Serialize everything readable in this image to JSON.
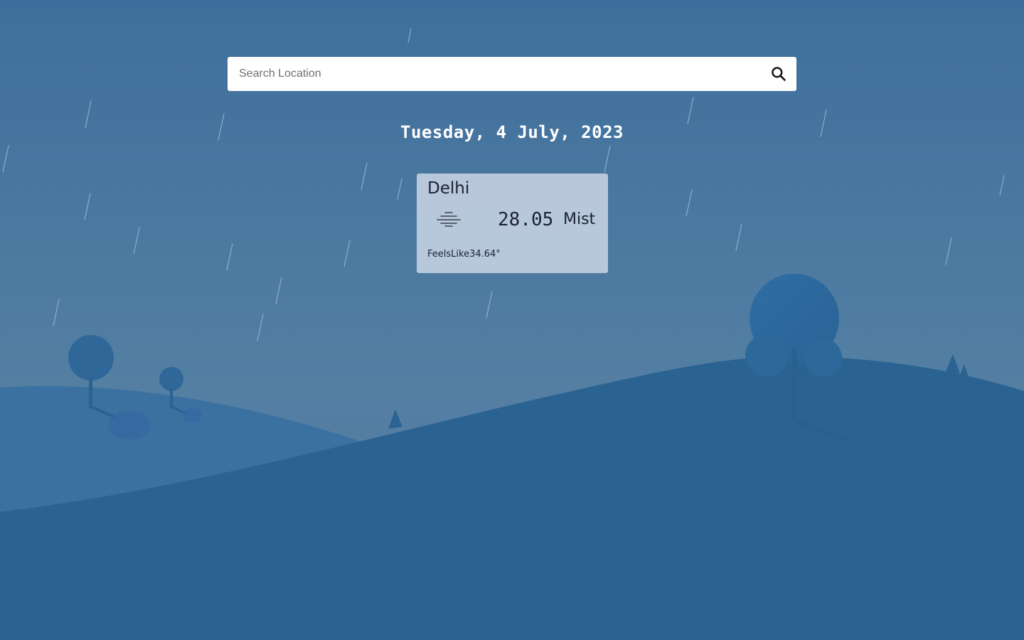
{
  "search": {
    "placeholder": "Search Location",
    "value": "",
    "icon": "search-icon"
  },
  "date_label": "Tuesday, 4 July, 2023",
  "weather": {
    "city": "Delhi",
    "icon": "mist-icon",
    "temperature": "28.05",
    "condition": "Mist",
    "feels_like": "FeelsLike34.64°"
  },
  "colors": {
    "sky": "#4a78a0",
    "hills_far": "#3b73a4",
    "hills_near": "#2a6291",
    "card_bg": "#c7d3e2",
    "text_dark": "#1c2233",
    "text_light": "#ffffff"
  }
}
